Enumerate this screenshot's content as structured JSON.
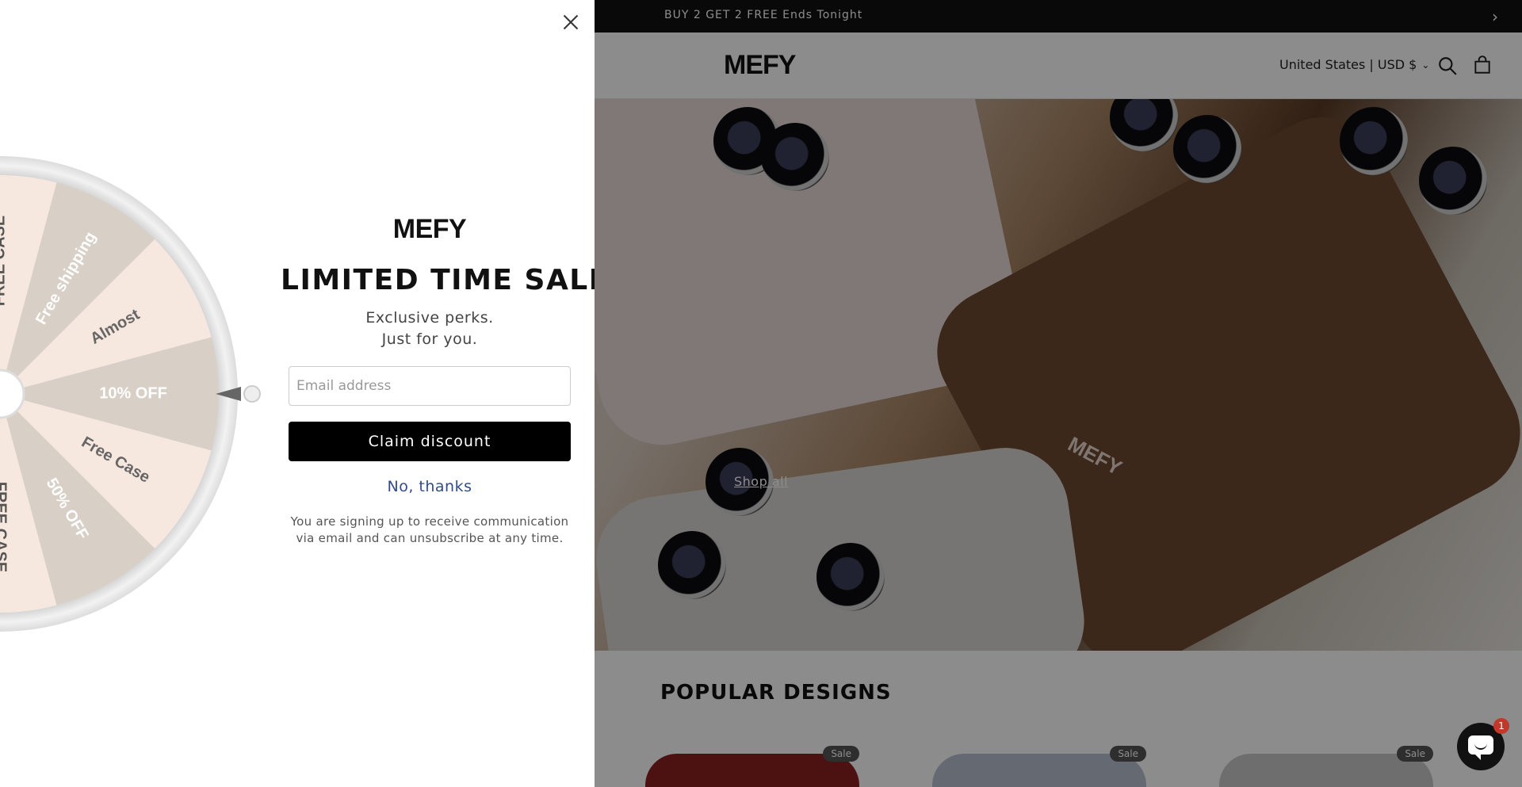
{
  "announcement": {
    "text": "BUY 2 GET 2 FREE Ends Tonight",
    "next_icon": "chevron-right-icon"
  },
  "header": {
    "logo": "MEFY",
    "locale": "United States | USD $",
    "search_icon": "search-icon",
    "cart_icon": "cart-icon"
  },
  "hero": {
    "shop_all": "Shop all",
    "case_logo": "MEFY"
  },
  "popular": {
    "title": "POPULAR DESIGNS",
    "cards": [
      {
        "badge": "Sale",
        "color": "#8a1f1f"
      },
      {
        "badge": "Sale",
        "color": "#b9c0cf"
      },
      {
        "badge": "Sale",
        "color": "#c9c9c9"
      }
    ]
  },
  "chat": {
    "count": "1"
  },
  "popup": {
    "brand": "MEFY",
    "headline": "LIMITED TIME SALE",
    "sub_line1": "Exclusive perks.",
    "sub_line2": "Just for you.",
    "email_placeholder": "Email address",
    "claim_label": "Claim discount",
    "no_thanks": "No, thanks",
    "legal_line1": "You are signing up to receive communication",
    "legal_line2": "via email and can unsubscribe at any time.",
    "wheel": {
      "segments": [
        {
          "label": "Free shipping",
          "color": "#d8cfc6"
        },
        {
          "label": "Almost",
          "color": "#f6e7df"
        },
        {
          "label": "10% OFF",
          "color": "#d8cfc6"
        },
        {
          "label": "Free Case",
          "color": "#f6e7df"
        },
        {
          "label": "50% OFF",
          "color": "#d8cfc6"
        },
        {
          "label": "FREE CASE",
          "color": "#f6e7df"
        },
        {
          "label": "FREE CASE",
          "color": "#f6e7df"
        }
      ]
    }
  }
}
